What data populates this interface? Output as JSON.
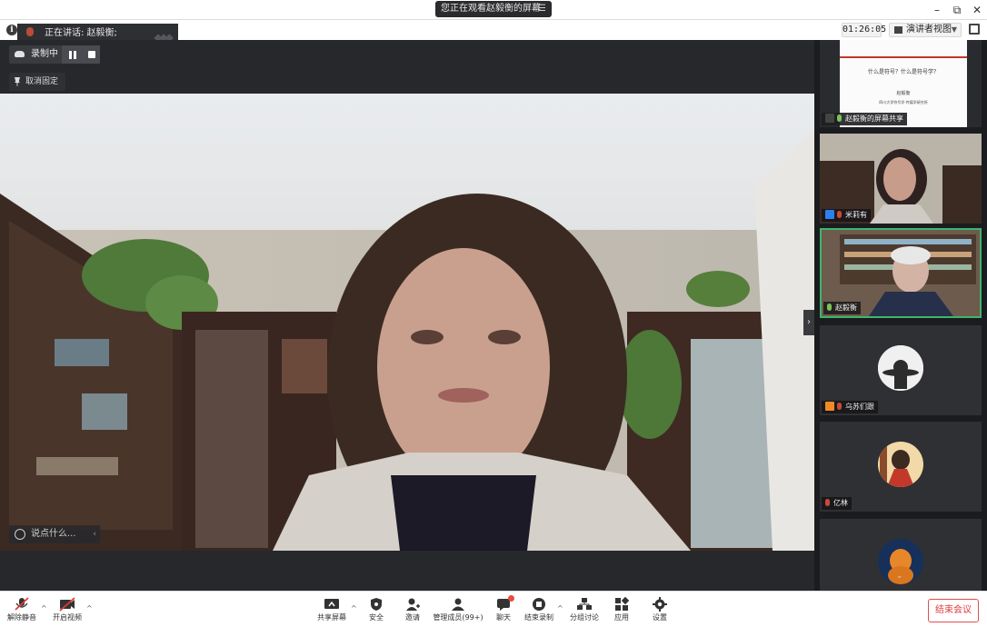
{
  "titlebar": {
    "share_status": "您正在观看赵毅衡的屏幕",
    "share_menu": "☰",
    "minimize": "–",
    "restore": "⧉",
    "close": "✕"
  },
  "topbar": {
    "speaking_label": "正在讲话: 赵毅衡;",
    "timer": "01:26:05",
    "view_label": "演讲者视图"
  },
  "stage": {
    "recording_label": "录制中",
    "unpin_label": "取消固定",
    "chat_placeholder": "说点什么..."
  },
  "sidebar": {
    "tiles": [
      {
        "name": "赵毅衡的屏幕共享",
        "slide_title": "什么是符号？什么是符号学？",
        "slide_author": "赵毅衡",
        "slide_org": "四川大学符号学-传媒学研究所"
      },
      {
        "name": "米莉有"
      },
      {
        "name": "赵毅衡"
      },
      {
        "name": "乌苏们跟"
      },
      {
        "name": "亿林"
      },
      {
        "name": ""
      }
    ]
  },
  "toolbar": {
    "mute": "解除静音",
    "video": "开启视频",
    "share": "共享屏幕",
    "security": "安全",
    "invite": "邀请",
    "members": "管理成员(99+)",
    "chat": "聊天",
    "record": "结束录制",
    "breakout": "分组讨论",
    "apps": "应用",
    "settings": "设置",
    "end": "结束会议"
  },
  "colors": {
    "accent_green": "#3eb66a",
    "end_red": "#e03a3a",
    "toolbar_bg": "#ffffff",
    "stage_bg": "#27282b"
  }
}
